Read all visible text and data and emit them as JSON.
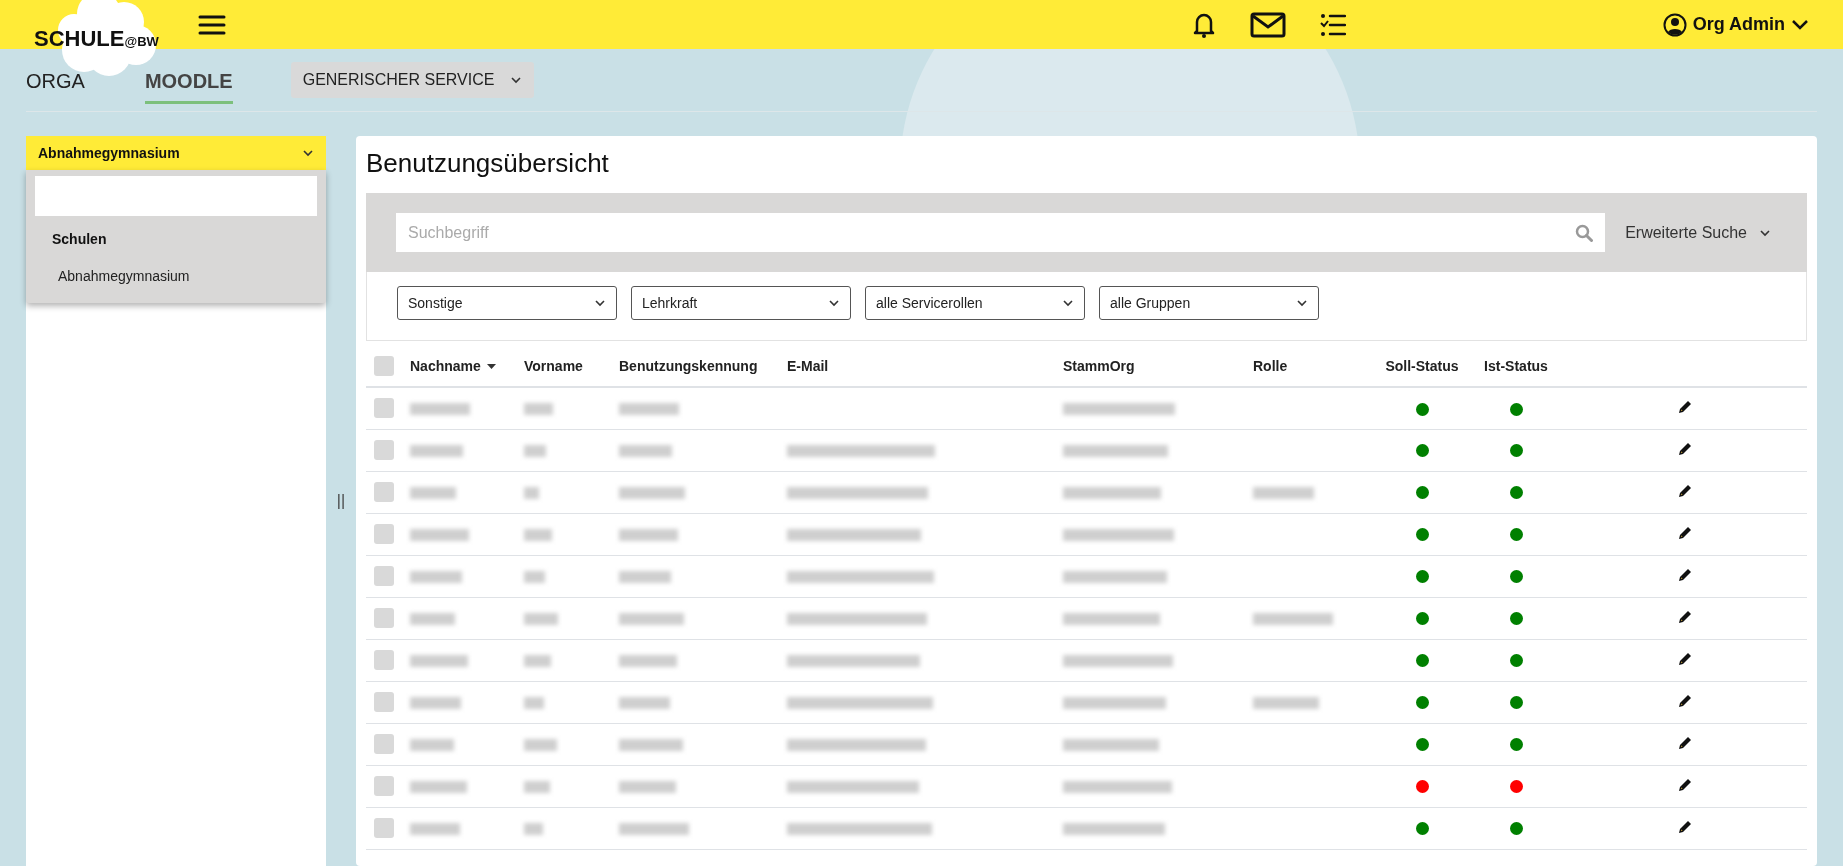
{
  "header": {
    "logo": "SCHULE",
    "logo_suffix": "@BW",
    "user": "Org Admin"
  },
  "nav": {
    "tabs": [
      {
        "label": "ORGA",
        "selected": false
      },
      {
        "label": "MOODLE",
        "selected": true
      }
    ],
    "service": "GENERISCHER SERVICE"
  },
  "sidebar": {
    "org_select": "Abnahmegymnasium",
    "group_label": "Schulen",
    "items": [
      {
        "label": "Abnahmegymnasium",
        "selected": false
      }
    ]
  },
  "resize_handle": "||",
  "main": {
    "title": "Benutzungsübersicht",
    "search": {
      "placeholder": "Suchbegriff"
    },
    "advanced_search": "Erweiterte Suche",
    "filters": [
      "Sonstige",
      "Lehrkraft",
      "alle Servicerollen",
      "alle Gruppen"
    ]
  },
  "table": {
    "header_checked": false,
    "columns": [
      {
        "label": "Nachname",
        "sorted": true
      },
      {
        "label": "Vorname",
        "sorted": false
      },
      {
        "label": "Benutzungskennung",
        "sorted": false
      },
      {
        "label": "E-Mail",
        "sorted": false
      },
      {
        "label": "StammOrg",
        "sorted": false
      },
      {
        "label": "Rolle",
        "sorted": false
      },
      {
        "label": "Soll-Status",
        "sorted": false
      },
      {
        "label": "Ist-Status",
        "sorted": false
      }
    ],
    "rows": [
      {
        "checked": false,
        "blurred": [
          true,
          true,
          true,
          false,
          true,
          false
        ],
        "soll_active": true,
        "ist_active": true
      },
      {
        "checked": false,
        "blurred": [
          true,
          true,
          true,
          true,
          true,
          false
        ],
        "soll_active": true,
        "ist_active": true
      },
      {
        "checked": false,
        "blurred": [
          true,
          true,
          true,
          true,
          true,
          true
        ],
        "soll_active": true,
        "ist_active": true
      },
      {
        "checked": false,
        "blurred": [
          true,
          true,
          true,
          true,
          true,
          false
        ],
        "soll_active": true,
        "ist_active": true
      },
      {
        "checked": false,
        "blurred": [
          true,
          true,
          true,
          true,
          true,
          false
        ],
        "soll_active": true,
        "ist_active": true
      },
      {
        "checked": false,
        "blurred": [
          true,
          true,
          true,
          true,
          true,
          true
        ],
        "soll_active": true,
        "ist_active": true
      },
      {
        "checked": false,
        "blurred": [
          true,
          true,
          true,
          true,
          true,
          false
        ],
        "soll_active": true,
        "ist_active": true
      },
      {
        "checked": false,
        "blurred": [
          true,
          true,
          true,
          true,
          true,
          true
        ],
        "soll_active": true,
        "ist_active": true
      },
      {
        "checked": false,
        "blurred": [
          true,
          true,
          true,
          true,
          true,
          false
        ],
        "soll_active": true,
        "ist_active": true
      },
      {
        "checked": false,
        "blurred": [
          true,
          true,
          true,
          true,
          true,
          false
        ],
        "soll_active": false,
        "ist_active": false
      },
      {
        "checked": false,
        "blurred": [
          true,
          true,
          true,
          true,
          true,
          false
        ],
        "soll_active": true,
        "ist_active": true
      }
    ]
  }
}
